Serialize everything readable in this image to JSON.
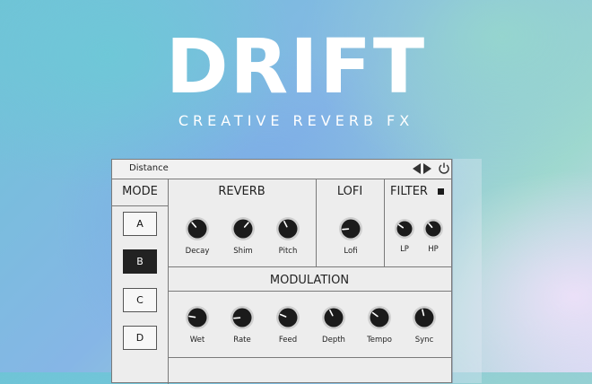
{
  "hero": {
    "title": "DRIFT",
    "subtitle": "CREATIVE REVERB FX"
  },
  "topbar": {
    "preset_name": "Distance",
    "prev_icon": "triangle-left-icon",
    "next_icon": "triangle-right-icon",
    "power_icon": "power-icon"
  },
  "sections": {
    "mode": "MODE",
    "reverb": "REVERB",
    "lofi": "LOFI",
    "filter": "FILTER",
    "modulation": "MODULATION"
  },
  "mode_buttons": [
    {
      "label": "A",
      "active": false
    },
    {
      "label": "B",
      "active": true
    },
    {
      "label": "C",
      "active": false
    },
    {
      "label": "D",
      "active": false
    }
  ],
  "reverb_knobs": [
    {
      "label": "Decay",
      "value": 0.35
    },
    {
      "label": "Shim",
      "value": 0.65
    },
    {
      "label": "Pitch",
      "value": 0.4
    }
  ],
  "lofi_knobs": [
    {
      "label": "Lofi",
      "value": 0.15
    }
  ],
  "filter_knobs": [
    {
      "label": "LP",
      "value": 0.3
    },
    {
      "label": "HP",
      "value": 0.35
    }
  ],
  "modulation_knobs": [
    {
      "label": "Wet",
      "value": 0.2
    },
    {
      "label": "Rate",
      "value": 0.15
    },
    {
      "label": "Feed",
      "value": 0.25
    },
    {
      "label": "Depth",
      "value": 0.4
    },
    {
      "label": "Tempo",
      "value": 0.3
    },
    {
      "label": "Sync",
      "value": 0.45
    }
  ],
  "colors": {
    "panel_bg": "#ededed",
    "knob": "#1b1b1b",
    "accent_text": "#ffffff"
  }
}
